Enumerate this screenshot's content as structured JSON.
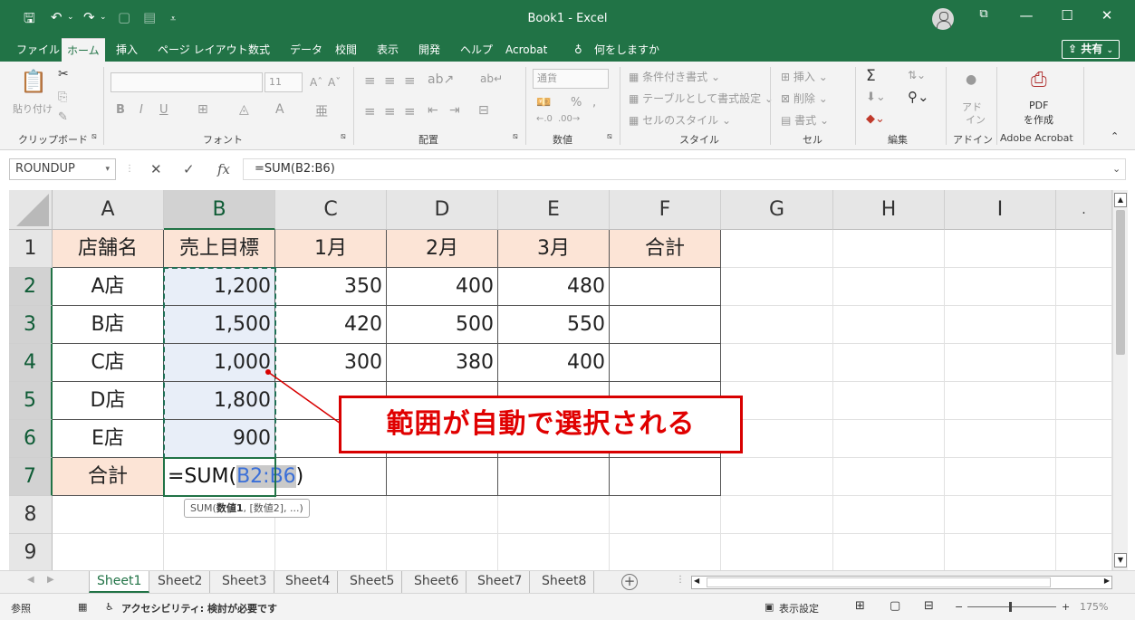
{
  "window": {
    "title": "Book1  -  Excel",
    "minimize": "—",
    "maximize": "☐",
    "close": "✕",
    "restore_icon": "⧉"
  },
  "tabs": [
    {
      "label": "ファイル",
      "active": false
    },
    {
      "label": "ホーム",
      "active": true
    },
    {
      "label": "挿入",
      "active": false
    },
    {
      "label": "ページ レイアウト",
      "active": false
    },
    {
      "label": "数式",
      "active": false
    },
    {
      "label": "データ",
      "active": false
    },
    {
      "label": "校閲",
      "active": false
    },
    {
      "label": "表示",
      "active": false
    },
    {
      "label": "開発",
      "active": false
    },
    {
      "label": "ヘルプ",
      "active": false
    },
    {
      "label": "Acrobat",
      "active": false
    },
    {
      "label": "何をしますか",
      "active": false
    }
  ],
  "share_label": "共有",
  "ribbon": {
    "clipboard": {
      "label": "クリップボード",
      "paste": "貼り付け"
    },
    "font": {
      "label": "フォント",
      "size": "11",
      "bold": "B",
      "italic": "I",
      "underline": "U"
    },
    "alignment": {
      "label": "配置"
    },
    "number": {
      "label": "数値",
      "format": "通貨"
    },
    "styles": {
      "label": "スタイル",
      "conditional": "条件付き書式",
      "table": "テーブルとして書式設定",
      "cell_styles": "セルのスタイル"
    },
    "cells": {
      "label": "セル",
      "insert": "挿入",
      "delete": "削除",
      "format": "書式"
    },
    "editing": {
      "label": "編集",
      "sigma": "Σ"
    },
    "addins": {
      "label": "アドイン",
      "top": "アド",
      "bottom": "イン"
    },
    "acrobat": {
      "label": "Adobe Acrobat",
      "pdf": "PDF",
      "create": "を作成"
    }
  },
  "formula_bar": {
    "name_box": "ROUNDUP",
    "cancel": "✕",
    "enter": "✓",
    "fx": "fx",
    "formula": "=SUM(B2:B6)"
  },
  "columns": [
    "A",
    "B",
    "C",
    "D",
    "E",
    "F",
    "G",
    "H",
    "I"
  ],
  "rows": [
    "1",
    "2",
    "3",
    "4",
    "5",
    "6",
    "7",
    "8",
    "9"
  ],
  "table": {
    "header": [
      "店舗名",
      "売上目標",
      "1月",
      "2月",
      "3月",
      "合計"
    ],
    "data": [
      [
        "A店",
        "1,200",
        "350",
        "400",
        "480"
      ],
      [
        "B店",
        "1,500",
        "420",
        "500",
        "550"
      ],
      [
        "C店",
        "1,000",
        "300",
        "380",
        "400"
      ],
      [
        "D店",
        "1,800",
        "",
        "",
        ""
      ],
      [
        "E店",
        "900",
        "",
        "",
        ""
      ]
    ],
    "total_label": "合計",
    "formula_prefix": "=SUM(",
    "formula_ref": "B2:B6",
    "formula_suffix": ")"
  },
  "tooltip": {
    "fn": "SUM(",
    "arg1": "数値1",
    "rest": ", [数値2], ...)"
  },
  "callout": "範囲が自動で選択される",
  "sheets": [
    "Sheet1",
    "Sheet2",
    "Sheet3",
    "Sheet4",
    "Sheet5",
    "Sheet6",
    "Sheet7",
    "Sheet8"
  ],
  "status": {
    "mode": "参照",
    "accessibility": "アクセシビリティ: 検討が必要です",
    "display_settings": "表示設定",
    "zoom_minus": "−",
    "zoom_plus": "+",
    "zoom": "175%"
  },
  "colors": {
    "excel_green": "#217346",
    "header_fill": "#fce4d6",
    "callout_red": "#e00000"
  }
}
